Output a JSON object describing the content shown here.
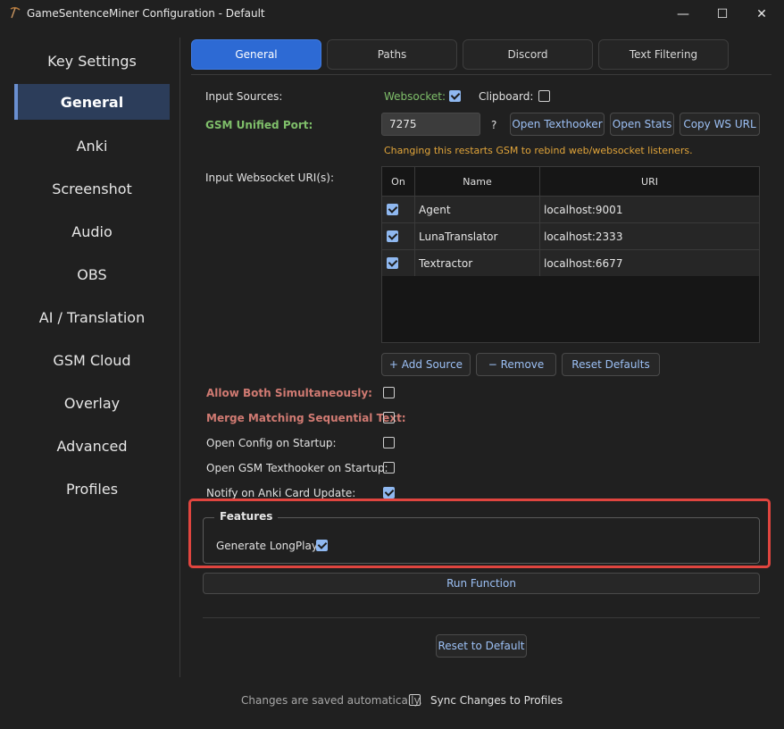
{
  "window": {
    "title": "GameSentenceMiner Configuration - Default",
    "minimize_glyph": "—",
    "maximize_glyph": "☐",
    "close_glyph": "✕"
  },
  "sidebar": {
    "items": [
      {
        "label": "Key Settings"
      },
      {
        "label": "General"
      },
      {
        "label": "Anki"
      },
      {
        "label": "Screenshot"
      },
      {
        "label": "Audio"
      },
      {
        "label": "OBS"
      },
      {
        "label": "AI / Translation"
      },
      {
        "label": "GSM Cloud"
      },
      {
        "label": "Overlay"
      },
      {
        "label": "Advanced"
      },
      {
        "label": "Profiles"
      }
    ],
    "active": "General"
  },
  "tabs": [
    {
      "label": "General"
    },
    {
      "label": "Paths"
    },
    {
      "label": "Discord"
    },
    {
      "label": "Text Filtering"
    }
  ],
  "general": {
    "input_sources_label": "Input Sources:",
    "websocket_label": "Websocket:",
    "websocket_checked": true,
    "clipboard_label": "Clipboard:",
    "clipboard_checked": false,
    "unified_port_label": "GSM Unified Port:",
    "unified_port_value": "7275",
    "help_glyph": "?",
    "open_texthooker": "Open Texthooker",
    "open_stats": "Open Stats",
    "copy_ws_url": "Copy WS URL",
    "port_warning": "Changing this restarts GSM to rebind web/websocket listeners.",
    "ws_uris_label": "Input Websocket URI(s):",
    "table": {
      "headers": [
        "On",
        "Name",
        "URI"
      ],
      "rows": [
        {
          "on": true,
          "name": "Agent",
          "uri": "localhost:9001"
        },
        {
          "on": true,
          "name": "LunaTranslator",
          "uri": "localhost:2333"
        },
        {
          "on": true,
          "name": "Textractor",
          "uri": "localhost:6677"
        }
      ]
    },
    "add_source": "+ Add Source",
    "remove": "− Remove",
    "reset_defaults": "Reset Defaults",
    "allow_both_label": "Allow Both Simultaneously:",
    "merge_matching_label": "Merge Matching Sequential Text:",
    "open_config_label": "Open Config on Startup:",
    "open_texthooker_startup_label": "Open GSM Texthooker on Startup:",
    "notify_anki_label": "Notify on Anki Card Update:",
    "features_title": "Features",
    "generate_longplay_label": "Generate LongPlay",
    "run_function": "Run Function",
    "reset_to_default": "Reset to Default"
  },
  "footer": {
    "saved_text": "Changes are saved automatically.",
    "sync_label": "Sync Changes to Profiles"
  },
  "colors": {
    "accent": "#2d6ad4",
    "highlight_frame": "#e0453f",
    "warning": "#e0a43a",
    "green_label": "#7fbf6a",
    "red_label": "#d07a72"
  }
}
